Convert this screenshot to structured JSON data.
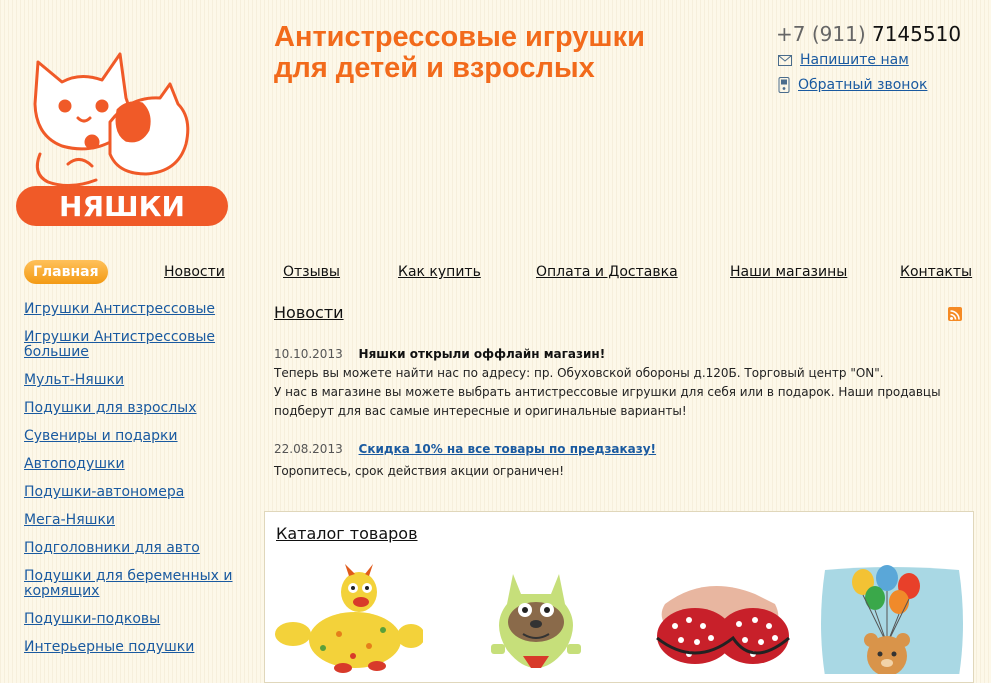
{
  "header": {
    "logo_text": "НЯШКИ",
    "headline": "Антистрессовые игрушки\nдля детей и взрослых",
    "phone_code": "+7 (911)",
    "phone_number": "7145510",
    "write_us": "Напишите нам",
    "callback": "Обратный звонок"
  },
  "nav": {
    "items": [
      "Главная",
      "Новости",
      "Отзывы",
      "Как купить",
      "Оплата и Доставка",
      "Наши магазины",
      "Контакты"
    ]
  },
  "sidebar": {
    "items": [
      "Игрушки Антистрессовые",
      "Игрушки Антистрессовые большие",
      "Мульт-Няшки",
      "Подушки для взрослых",
      "Сувениры и подарки",
      "Автоподушки",
      "Подушки-автономера",
      "Мега-Няшки",
      "Подголовники для авто",
      "Подушки для беременных и кормящих",
      "Подушки-подковы",
      "Интерьерные подушки"
    ]
  },
  "news": {
    "title": "Новости",
    "items": [
      {
        "date": "10.10.2013",
        "title": "Няшки открыли оффлайн магазин!",
        "lines": [
          "Теперь вы можете найти нас по адресу: пр. Обуховской обороны д.120Б. Торговый центр \"ON\".",
          "У нас в магазине вы можете выбрать антистрессовые игрушки для себя или в подарок. Наши продавцы подберут для вас самые интересные и оригинальные варианты!"
        ]
      },
      {
        "date": "22.08.2013",
        "title": "Скидка 10% на все товары по предзаказу!",
        "lines": [
          "Торопитесь, срок действия акции ограничен!"
        ]
      }
    ]
  },
  "catalog": {
    "title": "Каталог товаров",
    "products": [
      "yellow-giraffe-toy",
      "green-cat-toy",
      "red-bra-cushion",
      "bear-balloons-pillow"
    ]
  },
  "colors": {
    "accent": "#f26a1b",
    "link": "#1a5aa0",
    "nav_active": "#f39a14",
    "background": "#fdf8e9"
  }
}
